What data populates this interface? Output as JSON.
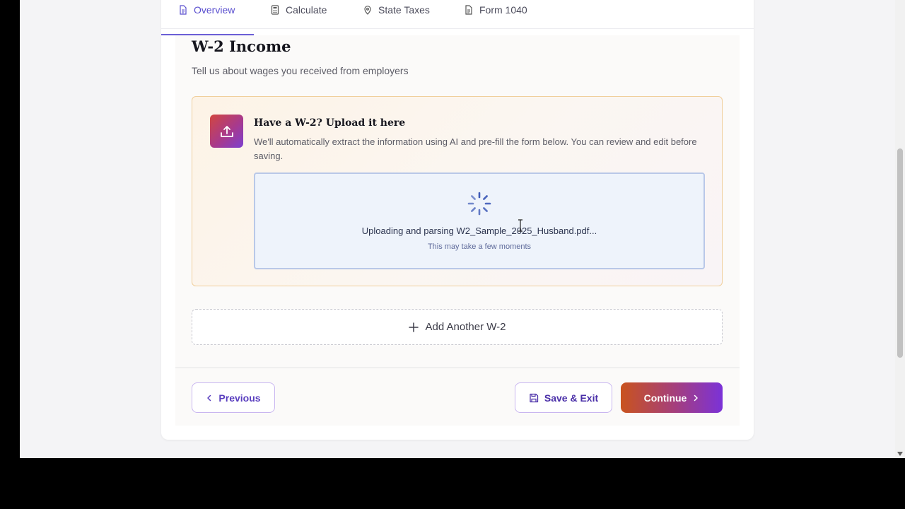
{
  "tabs": [
    {
      "label": "Overview",
      "icon": "document-icon",
      "active": true
    },
    {
      "label": "Calculate",
      "icon": "calculator-icon",
      "active": false
    },
    {
      "label": "State Taxes",
      "icon": "map-pin-icon",
      "active": false
    },
    {
      "label": "Form 1040",
      "icon": "file-icon",
      "active": false
    }
  ],
  "page": {
    "title": "W-2 Income",
    "subtitle": "Tell us about wages you received from employers"
  },
  "upload": {
    "heading": "Have a W-2? Upload it here",
    "description": "We'll automatically extract the information using AI and pre-fill the form below. You can review and edit before saving.",
    "status": "Uploading and parsing W2_Sample_2025_Husband.pdf...",
    "status_sub": "This may take a few moments"
  },
  "actions": {
    "add_another": "Add Another W-2",
    "previous": "Previous",
    "save_exit": "Save & Exit",
    "continue": "Continue"
  },
  "colors": {
    "accent": "#5a4fcf",
    "panel_border": "#f0cf9c",
    "dropzone_bg": "#eef3fb",
    "continue_gradient_start": "#c9531e",
    "continue_gradient_end": "#7b32d8"
  }
}
